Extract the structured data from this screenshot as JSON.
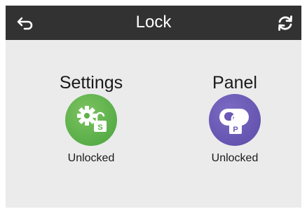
{
  "header": {
    "title": "Lock",
    "back_icon": "back-arrow-icon",
    "refresh_icon": "refresh-icon"
  },
  "locks": [
    {
      "name": "Settings",
      "status": "Unlocked",
      "badge": "S",
      "icon": "gear-lock-icon",
      "color": "#5cb247"
    },
    {
      "name": "Panel",
      "status": "Unlocked",
      "badge": "P",
      "icon": "panel-lock-icon",
      "color": "#6a58b5"
    }
  ],
  "colors": {
    "header_bg": "#323232",
    "page_bg": "#ebebeb"
  }
}
